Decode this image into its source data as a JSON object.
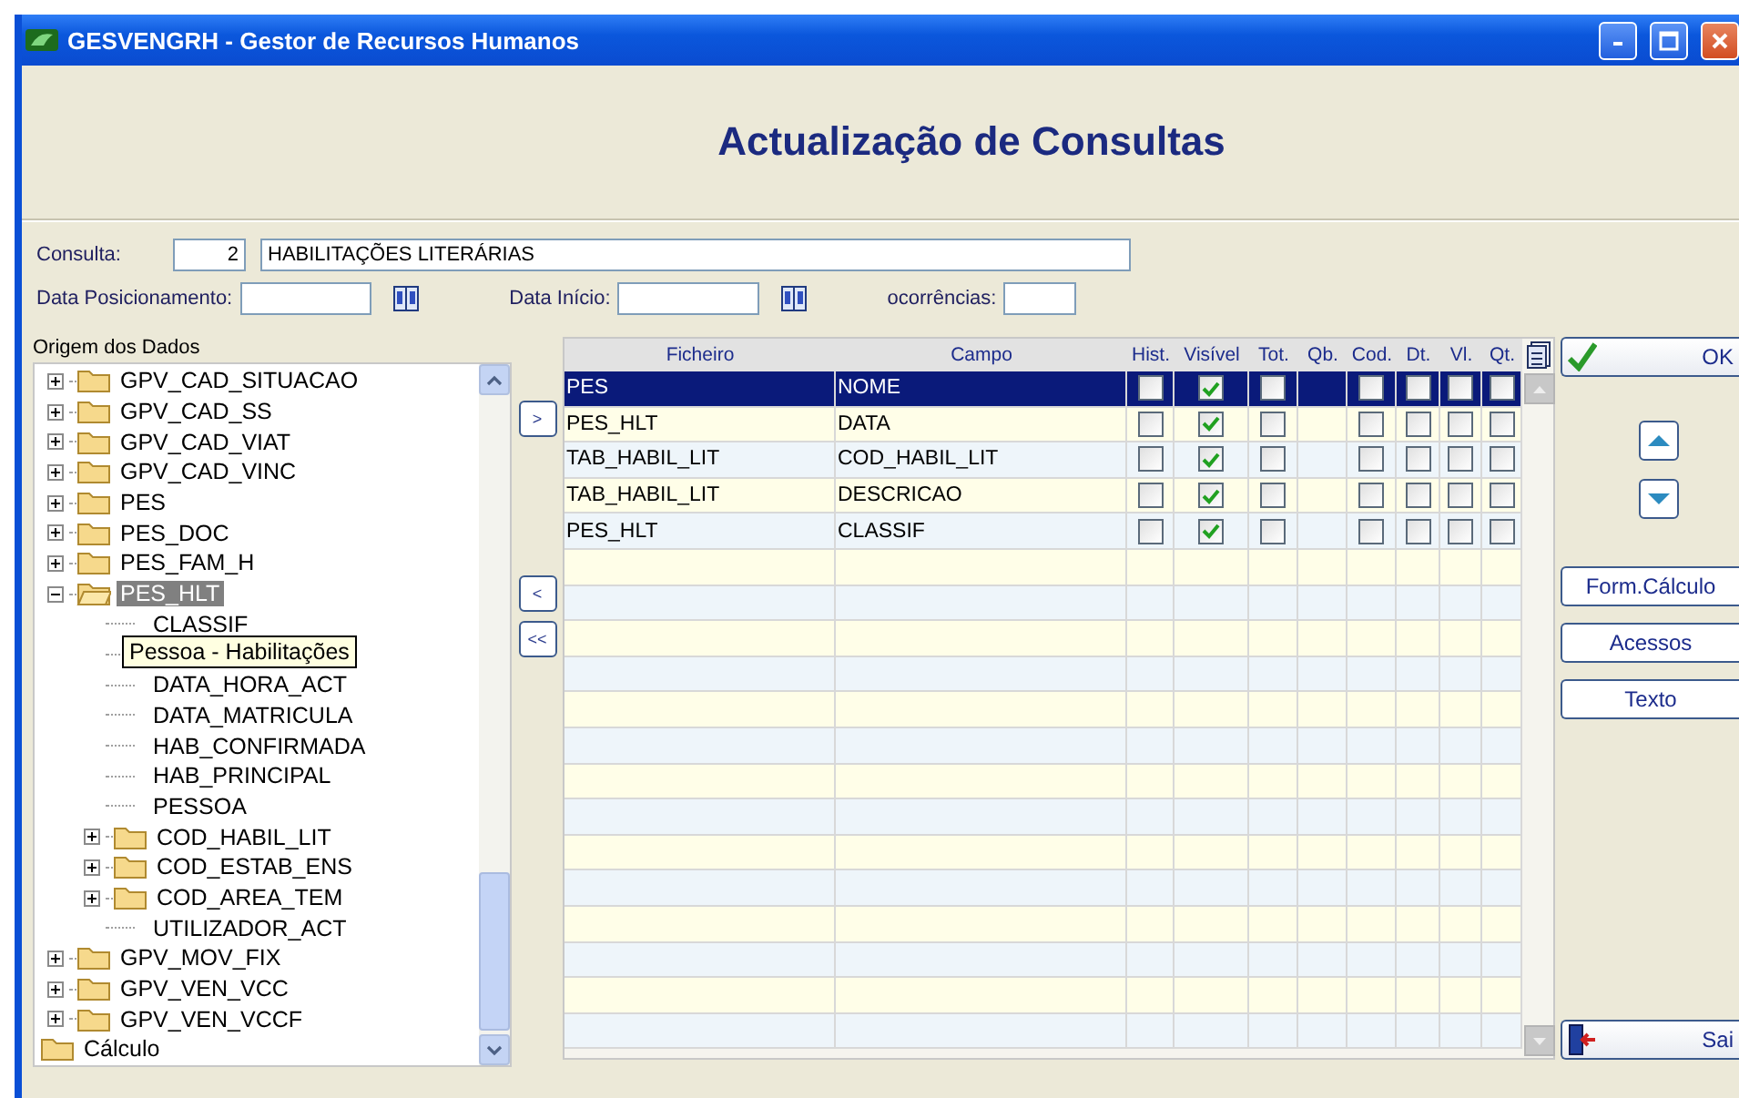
{
  "window": {
    "title": "GESVENGRH - Gestor de Recursos Humanos"
  },
  "heading": "Actualização de Consultas",
  "consulta": {
    "label": "Consulta:",
    "number": "2",
    "name": "HABILITAÇÕES LITERÁRIAS"
  },
  "filters": [
    {
      "label": "Data Posicionamento:",
      "kind": "date"
    },
    {
      "label": "Data Início:",
      "kind": "date"
    },
    {
      "label": "ocorrências:",
      "kind": "plain"
    }
  ],
  "tree": {
    "label": "Origem dos Dados",
    "items": [
      {
        "text": "GPV_CAD_SITUACAO",
        "kind": "folder",
        "expanded": false,
        "selected": false
      },
      {
        "text": "GPV_CAD_SS",
        "kind": "folder",
        "expanded": false,
        "selected": false
      },
      {
        "text": "GPV_CAD_VIAT",
        "kind": "folder",
        "expanded": false,
        "selected": false
      },
      {
        "text": "GPV_CAD_VINC",
        "kind": "folder",
        "expanded": false,
        "selected": false
      },
      {
        "text": "PES",
        "kind": "folder",
        "expanded": false,
        "selected": false
      },
      {
        "text": "PES_DOC",
        "kind": "folder",
        "expanded": false,
        "selected": false
      },
      {
        "text": "PES_FAM_H",
        "kind": "folder",
        "expanded": false,
        "selected": false
      },
      {
        "text": "PES_HLT",
        "kind": "folder",
        "expanded": true,
        "selected": true,
        "children": [
          {
            "text": "CLASSIF",
            "kind": "field",
            "selected": false
          },
          {
            "text": "Pessoa - Habilitações",
            "kind": "tooltip"
          },
          {
            "text": "DATA_HORA_ACT",
            "kind": "field",
            "selected": false
          },
          {
            "text": "DATA_MATRICULA",
            "kind": "field",
            "selected": false
          },
          {
            "text": "HAB_CONFIRMADA",
            "kind": "field",
            "selected": false
          },
          {
            "text": "HAB_PRINCIPAL",
            "kind": "field",
            "selected": false
          },
          {
            "text": "PESSOA",
            "kind": "field",
            "selected": false
          },
          {
            "text": "COD_HABIL_LIT",
            "kind": "folder",
            "expanded": false,
            "selected": false
          },
          {
            "text": "COD_ESTAB_ENS",
            "kind": "folder",
            "expanded": false,
            "selected": false
          },
          {
            "text": "COD_AREA_TEM",
            "kind": "folder",
            "expanded": false,
            "selected": false
          },
          {
            "text": "UTILIZADOR_ACT",
            "kind": "field",
            "selected": false
          }
        ]
      },
      {
        "text": "GPV_MOV_FIX",
        "kind": "folder",
        "expanded": false,
        "selected": false
      },
      {
        "text": "GPV_VEN_VCC",
        "kind": "folder",
        "expanded": false,
        "selected": false
      },
      {
        "text": "GPV_VEN_VCCF",
        "kind": "folder",
        "expanded": false,
        "selected": false
      },
      {
        "text": "Cálculo",
        "kind": "root-folder",
        "selected": false
      }
    ]
  },
  "move_buttons": [
    {
      "label": ">"
    },
    {
      "label": "<"
    },
    {
      "label": "<<"
    }
  ],
  "grid": {
    "columns": [
      {
        "label": "Ficheiro",
        "kind": "text"
      },
      {
        "label": "Campo",
        "kind": "text"
      },
      {
        "label": "Hist.",
        "kind": "check"
      },
      {
        "label": "Visível",
        "kind": "check"
      },
      {
        "label": "Tot.",
        "kind": "check"
      },
      {
        "label": "Qb.",
        "kind": "blank"
      },
      {
        "label": "Cod.",
        "kind": "check"
      },
      {
        "label": "Dt.",
        "kind": "check"
      },
      {
        "label": "Vl.",
        "kind": "check"
      },
      {
        "label": "Qt.",
        "kind": "check"
      }
    ],
    "rows": [
      {
        "texts": [
          "PES",
          "NOME"
        ],
        "selected": true,
        "checks": [
          false,
          true,
          false,
          false,
          false,
          false,
          false
        ]
      },
      {
        "texts": [
          "PES_HLT",
          "DATA"
        ],
        "selected": false,
        "checks": [
          false,
          true,
          false,
          false,
          false,
          false,
          false
        ]
      },
      {
        "texts": [
          "TAB_HABIL_LIT",
          "COD_HABIL_LIT"
        ],
        "selected": false,
        "checks": [
          false,
          true,
          false,
          false,
          false,
          false,
          false
        ]
      },
      {
        "texts": [
          "TAB_HABIL_LIT",
          "DESCRICAO"
        ],
        "selected": false,
        "checks": [
          false,
          true,
          false,
          false,
          false,
          false,
          false
        ]
      },
      {
        "texts": [
          "PES_HLT",
          "CLASSIF"
        ],
        "selected": false,
        "checks": [
          false,
          true,
          false,
          false,
          false,
          false,
          false
        ]
      }
    ]
  },
  "side_buttons": [
    {
      "label": "OK",
      "kind": "ok"
    },
    {
      "kind": "up"
    },
    {
      "kind": "down"
    },
    {
      "label": "Form.Cálculo",
      "kind": "plain"
    },
    {
      "label": "Acessos",
      "kind": "plain"
    },
    {
      "label": "Texto",
      "kind": "plain"
    },
    {
      "label": "Sai",
      "kind": "exit"
    }
  ]
}
